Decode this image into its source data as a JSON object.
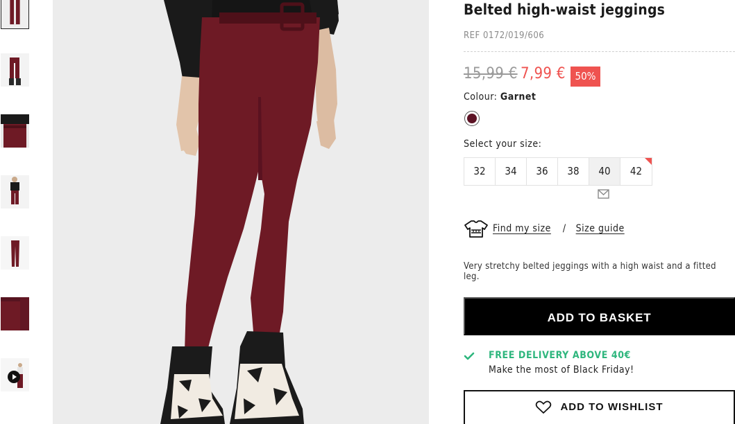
{
  "product": {
    "title": "Belted high-waist jeggings",
    "ref": "REF 0172/019/606",
    "old_price": "15,99 €",
    "new_price": "7,99 €",
    "discount": "50%",
    "colour_label": "Colour:",
    "colour_value": "Garnet",
    "swatch_color": "#5c1325",
    "select_size_label": "Select your size:",
    "sizes": [
      {
        "label": "32",
        "state": "available"
      },
      {
        "label": "34",
        "state": "available"
      },
      {
        "label": "36",
        "state": "available"
      },
      {
        "label": "38",
        "state": "available"
      },
      {
        "label": "40",
        "state": "sold-out"
      },
      {
        "label": "42",
        "state": "few-left"
      }
    ],
    "find_my_size": "Find my size",
    "separator": "/",
    "size_guide": "Size guide",
    "description": "Very stretchy belted jeggings with a high waist and a fitted leg.",
    "add_to_basket": "ADD TO BASKET",
    "free_delivery": "FREE DELIVERY ABOVE 40€",
    "promo": "Make the most of Black Friday!",
    "add_to_wishlist": "ADD TO WISHLIST"
  },
  "colors": {
    "sale_red": "#ef5350",
    "success_green": "#2eb67d",
    "garment": "#6e1a25"
  },
  "icons": {
    "mail": "envelope-icon",
    "shirt": "tshirt-icon",
    "check": "check-icon",
    "heart": "heart-icon",
    "play": "play-icon"
  }
}
